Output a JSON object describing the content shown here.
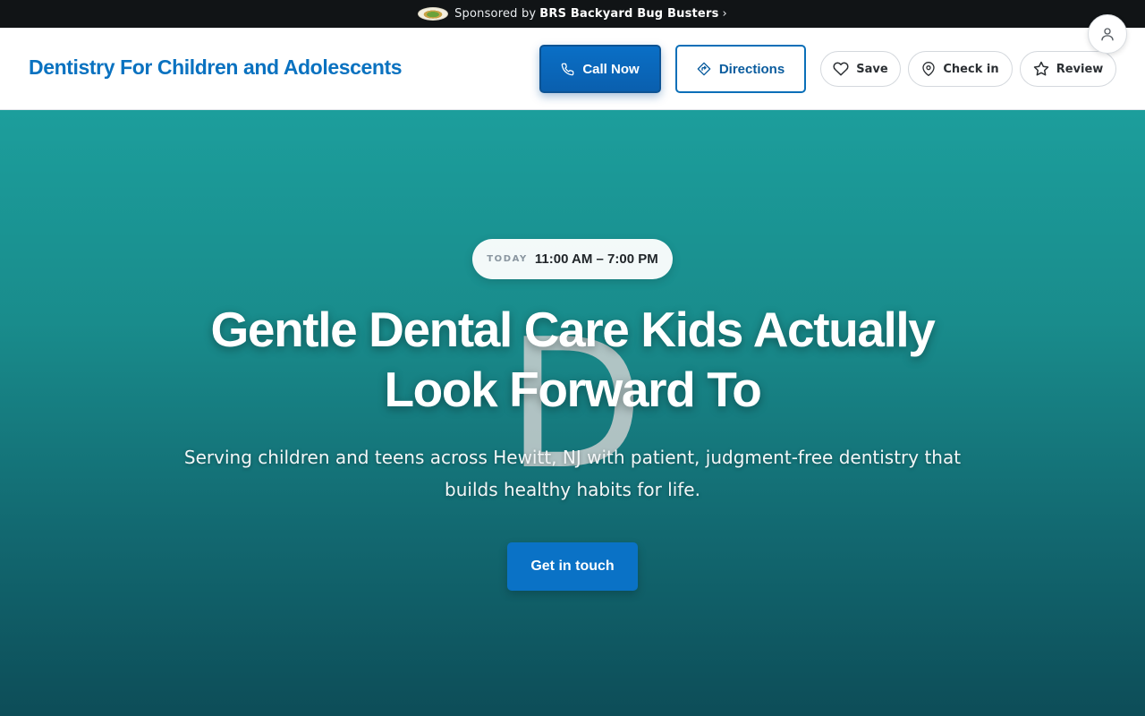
{
  "sponsor": {
    "prefix": "Sponsored by",
    "brand": "BRS Backyard Bug Busters",
    "chevron": "›",
    "logo_icon": "sponsor-logo"
  },
  "header": {
    "site_title": "Dentistry For Children and Adolescents",
    "call_label": "Call Now",
    "directions_label": "Directions",
    "save_label": "Save",
    "checkin_label": "Check in",
    "review_label": "Review",
    "colors": {
      "primary": "#0a72c0",
      "header_bg": "#ffffff",
      "sponsor_bg": "#111416"
    }
  },
  "hero": {
    "hours_label": "TODAY",
    "hours_value": "11:00 AM – 7:00 PM",
    "watermark_letter": "D",
    "headline": "Gentle Dental Care Kids Actually Look Forward To",
    "subtitle": "Serving children and teens across Hewitt, NJ with patient, judgment-free dentistry that builds healthy habits for life.",
    "cta_label": "Get in touch",
    "colors": {
      "gradient_top": "#1c9e9c",
      "gradient_bottom": "#0d4d58",
      "cta": "#0a72c6"
    }
  }
}
